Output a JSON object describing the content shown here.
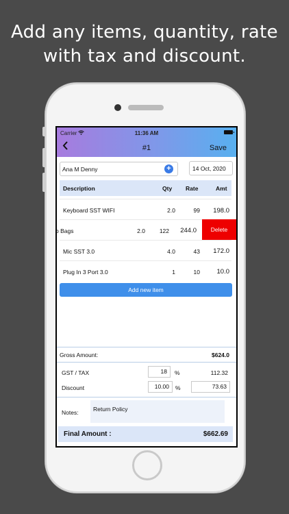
{
  "promo": {
    "line1": "Add any items, quantity, rate",
    "line2": "with tax and discount."
  },
  "status": {
    "carrier": "Carrier",
    "time": "11:36 AM"
  },
  "nav": {
    "back_icon": "chevron-left-icon",
    "title": "#1",
    "save_label": "Save"
  },
  "customer": {
    "name": "Ana M Denny",
    "add_icon": "plus-circle-icon",
    "date": "14 Oct, 2020"
  },
  "table": {
    "headers": {
      "description": "Description",
      "qty": "Qty",
      "rate": "Rate",
      "amt": "Amt"
    },
    "rows": [
      {
        "description": "Keyboard SST WIFI",
        "qty": "2.0",
        "rate": "99",
        "amt": "198.0"
      },
      {
        "description": "b Bags",
        "qty": "2.0",
        "rate": "122",
        "amt": "244.0",
        "delete_label": "Delete"
      },
      {
        "description": "Mic SST 3.0",
        "qty": "4.0",
        "rate": "43",
        "amt": "172.0"
      },
      {
        "description": "Plug In 3 Port 3.0",
        "qty": "1",
        "rate": "10",
        "amt": "10.0"
      }
    ],
    "add_label": "Add new item"
  },
  "summary": {
    "gross_label": "Gross Amount:",
    "gross_value": "$624.0",
    "tax_label": "GST / TAX",
    "tax_rate": "18",
    "tax_unit": "%",
    "tax_amount": "112.32",
    "discount_label": "Discount",
    "discount_rate": "10.00",
    "discount_unit": "%",
    "discount_amount": "73.63",
    "notes_label": "Notes:",
    "notes_value": "Return Policy",
    "final_label": "Final Amount :",
    "final_value": "$662.69"
  },
  "colors": {
    "accent": "#3f8fea",
    "delete": "#ee0000",
    "header_bg": "#dbe6f8"
  }
}
